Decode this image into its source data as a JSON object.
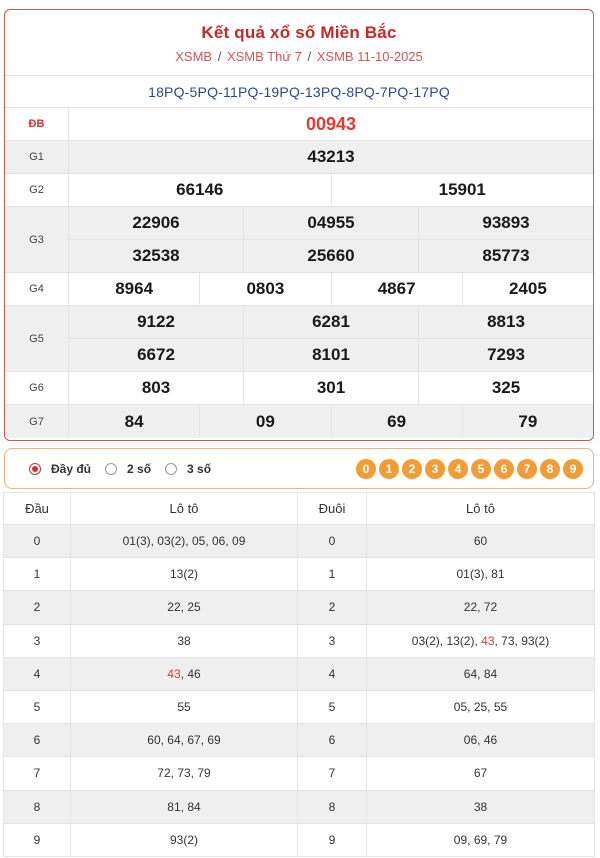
{
  "header": {
    "title": "Kết quả xổ số Miền Bắc",
    "breadcrumbs": [
      "XSMB",
      "XSMB Thứ 7",
      "XSMB 11-10-2025"
    ],
    "separator": "/"
  },
  "codes": "18PQ-5PQ-11PQ-19PQ-13PQ-8PQ-7PQ-17PQ",
  "prizes": [
    {
      "label": "ĐB",
      "lines": [
        [
          "00943"
        ]
      ]
    },
    {
      "label": "G1",
      "lines": [
        [
          "43213"
        ]
      ]
    },
    {
      "label": "G2",
      "lines": [
        [
          "66146",
          "15901"
        ]
      ]
    },
    {
      "label": "G3",
      "lines": [
        [
          "22906",
          "04955",
          "93893"
        ],
        [
          "32538",
          "25660",
          "85773"
        ]
      ]
    },
    {
      "label": "G4",
      "lines": [
        [
          "8964",
          "0803",
          "4867",
          "2405"
        ]
      ]
    },
    {
      "label": "G5",
      "lines": [
        [
          "9122",
          "6281",
          "8813"
        ],
        [
          "6672",
          "8101",
          "7293"
        ]
      ]
    },
    {
      "label": "G6",
      "lines": [
        [
          "803",
          "301",
          "325"
        ]
      ]
    },
    {
      "label": "G7",
      "lines": [
        [
          "84",
          "09",
          "69",
          "79"
        ]
      ]
    }
  ],
  "display_options": {
    "items": [
      "Đầy đủ",
      "2 số",
      "3 số"
    ],
    "selected": "Đầy đủ"
  },
  "digit_filters": [
    "0",
    "1",
    "2",
    "3",
    "4",
    "5",
    "6",
    "7",
    "8",
    "9"
  ],
  "colors": {
    "accent_red": "#d32f2f",
    "special_red": "#e53935",
    "digit_orange": "#f39c35",
    "code_blue": "#2a4b8d"
  },
  "loto_table": {
    "headers": [
      "Đầu",
      "Lô tô",
      "Đuôi",
      "Lô tô"
    ],
    "highlight": "43",
    "rows": [
      {
        "dau": "0",
        "dau_loto": "01(3), 03(2), 05, 06, 09",
        "duoi": "0",
        "duoi_loto": "60"
      },
      {
        "dau": "1",
        "dau_loto": "13(2)",
        "duoi": "1",
        "duoi_loto": "01(3), 81"
      },
      {
        "dau": "2",
        "dau_loto": "22, 25",
        "duoi": "2",
        "duoi_loto": "22, 72"
      },
      {
        "dau": "3",
        "dau_loto": "38",
        "duoi": "3",
        "duoi_loto": "03(2), 13(2), 43, 73, 93(2)"
      },
      {
        "dau": "4",
        "dau_loto": "43, 46",
        "duoi": "4",
        "duoi_loto": "64, 84"
      },
      {
        "dau": "5",
        "dau_loto": "55",
        "duoi": "5",
        "duoi_loto": "05, 25, 55"
      },
      {
        "dau": "6",
        "dau_loto": "60, 64, 67, 69",
        "duoi": "6",
        "duoi_loto": "06, 46"
      },
      {
        "dau": "7",
        "dau_loto": "72, 73, 79",
        "duoi": "7",
        "duoi_loto": "67"
      },
      {
        "dau": "8",
        "dau_loto": "81, 84",
        "duoi": "8",
        "duoi_loto": "38"
      },
      {
        "dau": "9",
        "dau_loto": "93(2)",
        "duoi": "9",
        "duoi_loto": "09, 69, 79"
      }
    ]
  }
}
